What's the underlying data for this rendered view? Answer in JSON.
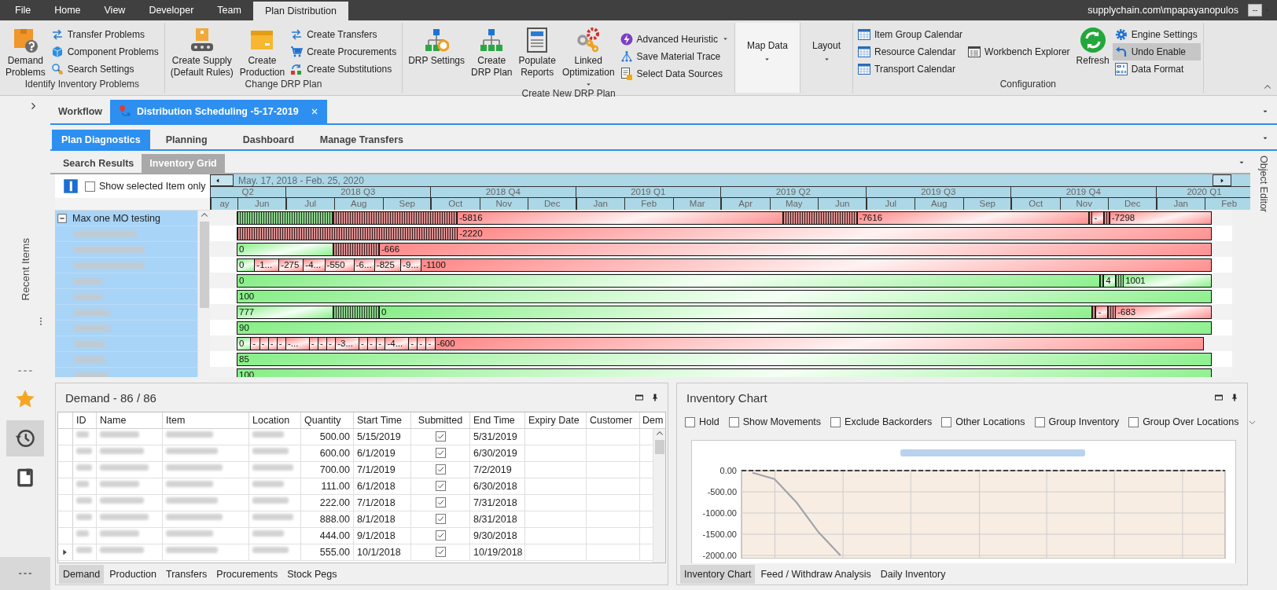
{
  "menu": {
    "tabs": [
      {
        "label": "File",
        "selected": false
      },
      {
        "label": "Home",
        "selected": false
      },
      {
        "label": "View",
        "selected": false
      },
      {
        "label": "Developer",
        "selected": false
      },
      {
        "label": "Team",
        "selected": false
      },
      {
        "label": "Plan Distribution",
        "selected": true
      }
    ],
    "user": "supplychain.com\\mpapayanopulos",
    "account_button": "--"
  },
  "ribbon": {
    "groups": [
      {
        "label": "Identify Inventory Problems",
        "highlighted": false,
        "items": [
          {
            "kind": "large",
            "label": "Demand\nProblems"
          },
          {
            "kind": "stack",
            "items": [
              {
                "kind": "small",
                "label": "Transfer Problems",
                "highlighted": false
              },
              {
                "kind": "small",
                "label": "Component Problems",
                "highlighted": false
              },
              {
                "kind": "small",
                "label": "Search Settings",
                "highlighted": false
              }
            ]
          }
        ]
      },
      {
        "label": "Change DRP Plan",
        "highlighted": false,
        "items": [
          {
            "kind": "large",
            "label": "Create Supply\n(Default Rules)"
          },
          {
            "kind": "large",
            "label": "Create\nProduction"
          },
          {
            "kind": "stack",
            "items": [
              {
                "kind": "small",
                "label": "Create Transfers",
                "highlighted": false
              },
              {
                "kind": "small",
                "label": "Create Procurements",
                "highlighted": false
              },
              {
                "kind": "small",
                "label": "Create Substitutions",
                "highlighted": false
              }
            ]
          }
        ]
      },
      {
        "label": "Create New DRP Plan",
        "highlighted": false,
        "items": [
          {
            "kind": "large",
            "label": "DRP Settings"
          },
          {
            "kind": "large",
            "label": "Create\nDRP Plan"
          },
          {
            "kind": "large",
            "label": "Populate\nReports"
          },
          {
            "kind": "large-menu",
            "label": "Linked\nOptimization"
          },
          {
            "kind": "stack",
            "items": [
              {
                "kind": "small-menu",
                "label": "Advanced Heuristic",
                "highlighted": false
              },
              {
                "kind": "small",
                "label": "Save Material Trace",
                "highlighted": false
              },
              {
                "kind": "small",
                "label": "Select Data Sources",
                "highlighted": false
              }
            ]
          }
        ]
      },
      {
        "highlighted": true,
        "items": [
          {
            "kind": "menu",
            "label": "Map Data"
          }
        ]
      },
      {
        "highlighted": false,
        "items": [
          {
            "kind": "menu",
            "label": "Layout"
          }
        ]
      },
      {
        "label": "Configuration",
        "highlighted": false,
        "items": [
          {
            "kind": "stack",
            "items": [
              {
                "kind": "small",
                "label": "Item Group Calendar",
                "highlighted": false
              },
              {
                "kind": "small",
                "label": "Resource Calendar",
                "highlighted": false
              },
              {
                "kind": "small",
                "label": "Transport Calendar",
                "highlighted": false
              }
            ]
          },
          {
            "kind": "stack",
            "items": [
              {
                "kind": "small",
                "label": "Workbench Explorer",
                "highlighted": false
              }
            ]
          },
          {
            "kind": "large",
            "label": "Refresh"
          },
          {
            "kind": "stack",
            "items": [
              {
                "kind": "small",
                "label": "Engine Settings",
                "highlighted": false
              },
              {
                "kind": "small",
                "label": "Undo Enable",
                "highlighted": true
              },
              {
                "kind": "small",
                "label": "Data Format",
                "highlighted": false
              }
            ]
          }
        ]
      }
    ]
  },
  "sidebar": {
    "label": "Recent Items",
    "items": [
      {
        "kind": "favorites",
        "selected": false
      },
      {
        "kind": "history",
        "selected": true
      },
      {
        "kind": "notebook",
        "selected": false
      }
    ]
  },
  "document_tabs": [
    {
      "label": "Workflow",
      "selected": false,
      "closable": false
    },
    {
      "label": "Distribution Scheduling -5-17-2019",
      "selected": true,
      "closable": true
    }
  ],
  "view_tabs": [
    {
      "label": "Plan Diagnostics",
      "selected": true
    },
    {
      "label": "Planning",
      "selected": false
    },
    {
      "label": "Dashboard",
      "selected": false
    },
    {
      "label": "Manage Transfers",
      "selected": false
    }
  ],
  "grid_tabs": [
    {
      "label": "Search Results",
      "selected": false
    },
    {
      "label": "Inventory Grid",
      "selected": true
    }
  ],
  "inventory_grid": {
    "show_selected_only": {
      "label": "Show selected Item only",
      "checked": false
    },
    "range": "May. 17, 2018 - Feb. 25, 2020",
    "quarters": [
      {
        "label": "Q2",
        "months": [
          "ay",
          "Jun"
        ]
      },
      {
        "label": "2018 Q3",
        "months": [
          "Jul",
          "Aug",
          "Sep"
        ]
      },
      {
        "label": "2018 Q4",
        "months": [
          "Oct",
          "Nov",
          "Dec"
        ]
      },
      {
        "label": "2019 Q1",
        "months": [
          "Jan",
          "Feb",
          "Mar"
        ]
      },
      {
        "label": "2019 Q2",
        "months": [
          "Apr",
          "May",
          "Jun"
        ]
      },
      {
        "label": "2019 Q3",
        "months": [
          "Jul",
          "Aug",
          "Sep"
        ]
      },
      {
        "label": "2019 Q4",
        "months": [
          "Oct",
          "Nov",
          "Dec"
        ]
      },
      {
        "label": "2020 Q1",
        "months": [
          "Jan",
          "Feb"
        ]
      }
    ],
    "tree": [
      {
        "label": "Max one MO testing",
        "expanded": true,
        "selected": true,
        "children": [
          {
            "selected": true
          },
          {
            "selected": true
          },
          {
            "selected": true
          },
          {
            "selected": true
          },
          {
            "selected": true
          },
          {
            "selected": true
          },
          {
            "selected": true
          },
          {
            "selected": true
          },
          {
            "selected": true
          },
          {
            "selected": true
          }
        ]
      }
    ],
    "rows": [
      {
        "segments": [
          {
            "kind": "hatch-surplus"
          },
          {
            "kind": "hatch-shortage"
          },
          {
            "kind": "shortage",
            "label": "-5816"
          },
          {
            "kind": "hatch-shortage"
          },
          {
            "kind": "shortage",
            "label": "-7616"
          },
          {
            "kind": "hatch-shortage"
          },
          {
            "kind": "shortage",
            "label": "-"
          },
          {
            "kind": "hatch-shortage"
          },
          {
            "kind": "shortage",
            "label": "-7298"
          }
        ]
      },
      {
        "segments": [
          {
            "kind": "hatch-shortage"
          },
          {
            "kind": "shortage",
            "label": "-2220"
          }
        ]
      },
      {
        "segments": [
          {
            "kind": "surplus",
            "label": "0"
          },
          {
            "kind": "hatch-shortage"
          },
          {
            "kind": "shortage",
            "label": "-666"
          }
        ]
      },
      {
        "segments": [
          {
            "kind": "surplus",
            "label": "0"
          },
          {
            "kind": "shortage",
            "label": "-1..."
          },
          {
            "kind": "shortage",
            "label": "-275"
          },
          {
            "kind": "shortage",
            "label": "-4..."
          },
          {
            "kind": "shortage",
            "label": "-550"
          },
          {
            "kind": "shortage",
            "label": "-6..."
          },
          {
            "kind": "shortage",
            "label": "-825"
          },
          {
            "kind": "shortage",
            "label": "-9..."
          },
          {
            "kind": "shortage",
            "label": "-1100"
          }
        ]
      },
      {
        "segments": [
          {
            "kind": "surplus",
            "label": "0"
          },
          {
            "kind": "hatch-surplus"
          },
          {
            "kind": "surplus",
            "label": "4"
          },
          {
            "kind": "hatch-surplus"
          },
          {
            "kind": "surplus",
            "label": "1001"
          }
        ]
      },
      {
        "segments": [
          {
            "kind": "surplus",
            "label": "100"
          }
        ]
      },
      {
        "segments": [
          {
            "kind": "surplus",
            "label": "777"
          },
          {
            "kind": "hatch-surplus"
          },
          {
            "kind": "surplus",
            "label": "0"
          },
          {
            "kind": "hatch-shortage"
          },
          {
            "kind": "shortage",
            "label": "-"
          },
          {
            "kind": "hatch-shortage"
          },
          {
            "kind": "shortage",
            "label": "-683"
          }
        ]
      },
      {
        "segments": [
          {
            "kind": "surplus",
            "label": "90"
          }
        ]
      },
      {
        "segments": [
          {
            "kind": "surplus",
            "label": "0"
          },
          {
            "kind": "shortage",
            "label": "-"
          },
          {
            "kind": "shortage",
            "label": "-"
          },
          {
            "kind": "shortage",
            "label": "-"
          },
          {
            "kind": "shortage",
            "label": "-"
          },
          {
            "kind": "shortage",
            "label": "-..."
          },
          {
            "kind": "shortage",
            "label": "-"
          },
          {
            "kind": "shortage",
            "label": "-"
          },
          {
            "kind": "shortage",
            "label": "-"
          },
          {
            "kind": "shortage",
            "label": "-3..."
          },
          {
            "kind": "shortage",
            "label": "-"
          },
          {
            "kind": "shortage",
            "label": "-"
          },
          {
            "kind": "shortage",
            "label": "-"
          },
          {
            "kind": "shortage",
            "label": "-4..."
          },
          {
            "kind": "shortage",
            "label": "-"
          },
          {
            "kind": "shortage",
            "label": "-"
          },
          {
            "kind": "shortage",
            "label": "-"
          },
          {
            "kind": "shortage",
            "label": "-600"
          }
        ]
      },
      {
        "segments": [
          {
            "kind": "surplus",
            "label": "85"
          }
        ]
      },
      {
        "segments": [
          {
            "kind": "surplus",
            "label": "100"
          }
        ]
      }
    ]
  },
  "demand_panel": {
    "title": "Demand - 86 / 86",
    "columns": [
      "ID",
      "Name",
      "Item",
      "Location",
      "Quantity",
      "Start Time",
      "Submitted",
      "End Time",
      "Expiry Date",
      "Customer",
      "Dem"
    ],
    "rows": [
      {
        "quantity": "500.00",
        "start_time": "5/15/2019",
        "submitted": true,
        "end_time": "5/31/2019",
        "current": false
      },
      {
        "quantity": "600.00",
        "start_time": "6/1/2019",
        "submitted": true,
        "end_time": "6/30/2019",
        "current": false
      },
      {
        "quantity": "700.00",
        "start_time": "7/1/2019",
        "submitted": true,
        "end_time": "7/2/2019",
        "current": false
      },
      {
        "quantity": "111.00",
        "start_time": "6/1/2018",
        "submitted": true,
        "end_time": "6/30/2018",
        "current": false
      },
      {
        "quantity": "222.00",
        "start_time": "7/1/2018",
        "submitted": true,
        "end_time": "7/31/2018",
        "current": false
      },
      {
        "quantity": "888.00",
        "start_time": "8/1/2018",
        "submitted": true,
        "end_time": "8/31/2018",
        "current": false
      },
      {
        "quantity": "444.00",
        "start_time": "9/1/2018",
        "submitted": true,
        "end_time": "9/30/2018",
        "current": false
      },
      {
        "quantity": "555.00",
        "start_time": "10/1/2018",
        "submitted": true,
        "end_time": "10/19/2018",
        "current": true
      }
    ],
    "tabs": [
      {
        "label": "Demand",
        "selected": true
      },
      {
        "label": "Production",
        "selected": false
      },
      {
        "label": "Transfers",
        "selected": false
      },
      {
        "label": "Procurements",
        "selected": false
      },
      {
        "label": "Stock Pegs",
        "selected": false
      }
    ]
  },
  "chart_panel": {
    "title": "Inventory Chart",
    "options": [
      {
        "label": "Hold",
        "checked": false
      },
      {
        "label": "Show Movements",
        "checked": false
      },
      {
        "label": "Exclude Backorders",
        "checked": false
      },
      {
        "label": "Other Locations",
        "checked": false
      },
      {
        "label": "Group Inventory",
        "checked": false
      },
      {
        "label": "Group Over Locations",
        "checked": false
      }
    ],
    "chart_data": {
      "type": "line",
      "grid": true,
      "ylim": [
        -2000,
        0
      ],
      "categories": [
        null,
        null,
        null,
        null,
        null,
        null,
        null,
        null,
        null,
        null,
        null,
        null,
        null,
        null,
        null,
        null,
        null,
        null,
        null,
        null,
        null,
        null
      ],
      "yticks": [
        {
          "value": 0,
          "label": "0.00"
        },
        {
          "value": -500,
          "label": "-500.00"
        },
        {
          "value": -1000,
          "label": "-1000.00"
        },
        {
          "value": -1500,
          "label": "-1500.00"
        },
        {
          "value": -2000,
          "label": "-2000.00"
        }
      ],
      "series": [
        {
          "color": "#a0a4aa",
          "values": [
            -50,
            -200,
            -750,
            -1450,
            -2000,
            null,
            null,
            null,
            null,
            null,
            null,
            null,
            null,
            null,
            null,
            null,
            null,
            null,
            null,
            null,
            null,
            null
          ]
        }
      ]
    },
    "tabs": [
      {
        "label": "Inventory Chart",
        "selected": true
      },
      {
        "label": "Feed / Withdraw Analysis",
        "selected": false
      },
      {
        "label": "Daily Inventory",
        "selected": false
      }
    ]
  },
  "side_panel": {
    "label": "Object Editor"
  }
}
